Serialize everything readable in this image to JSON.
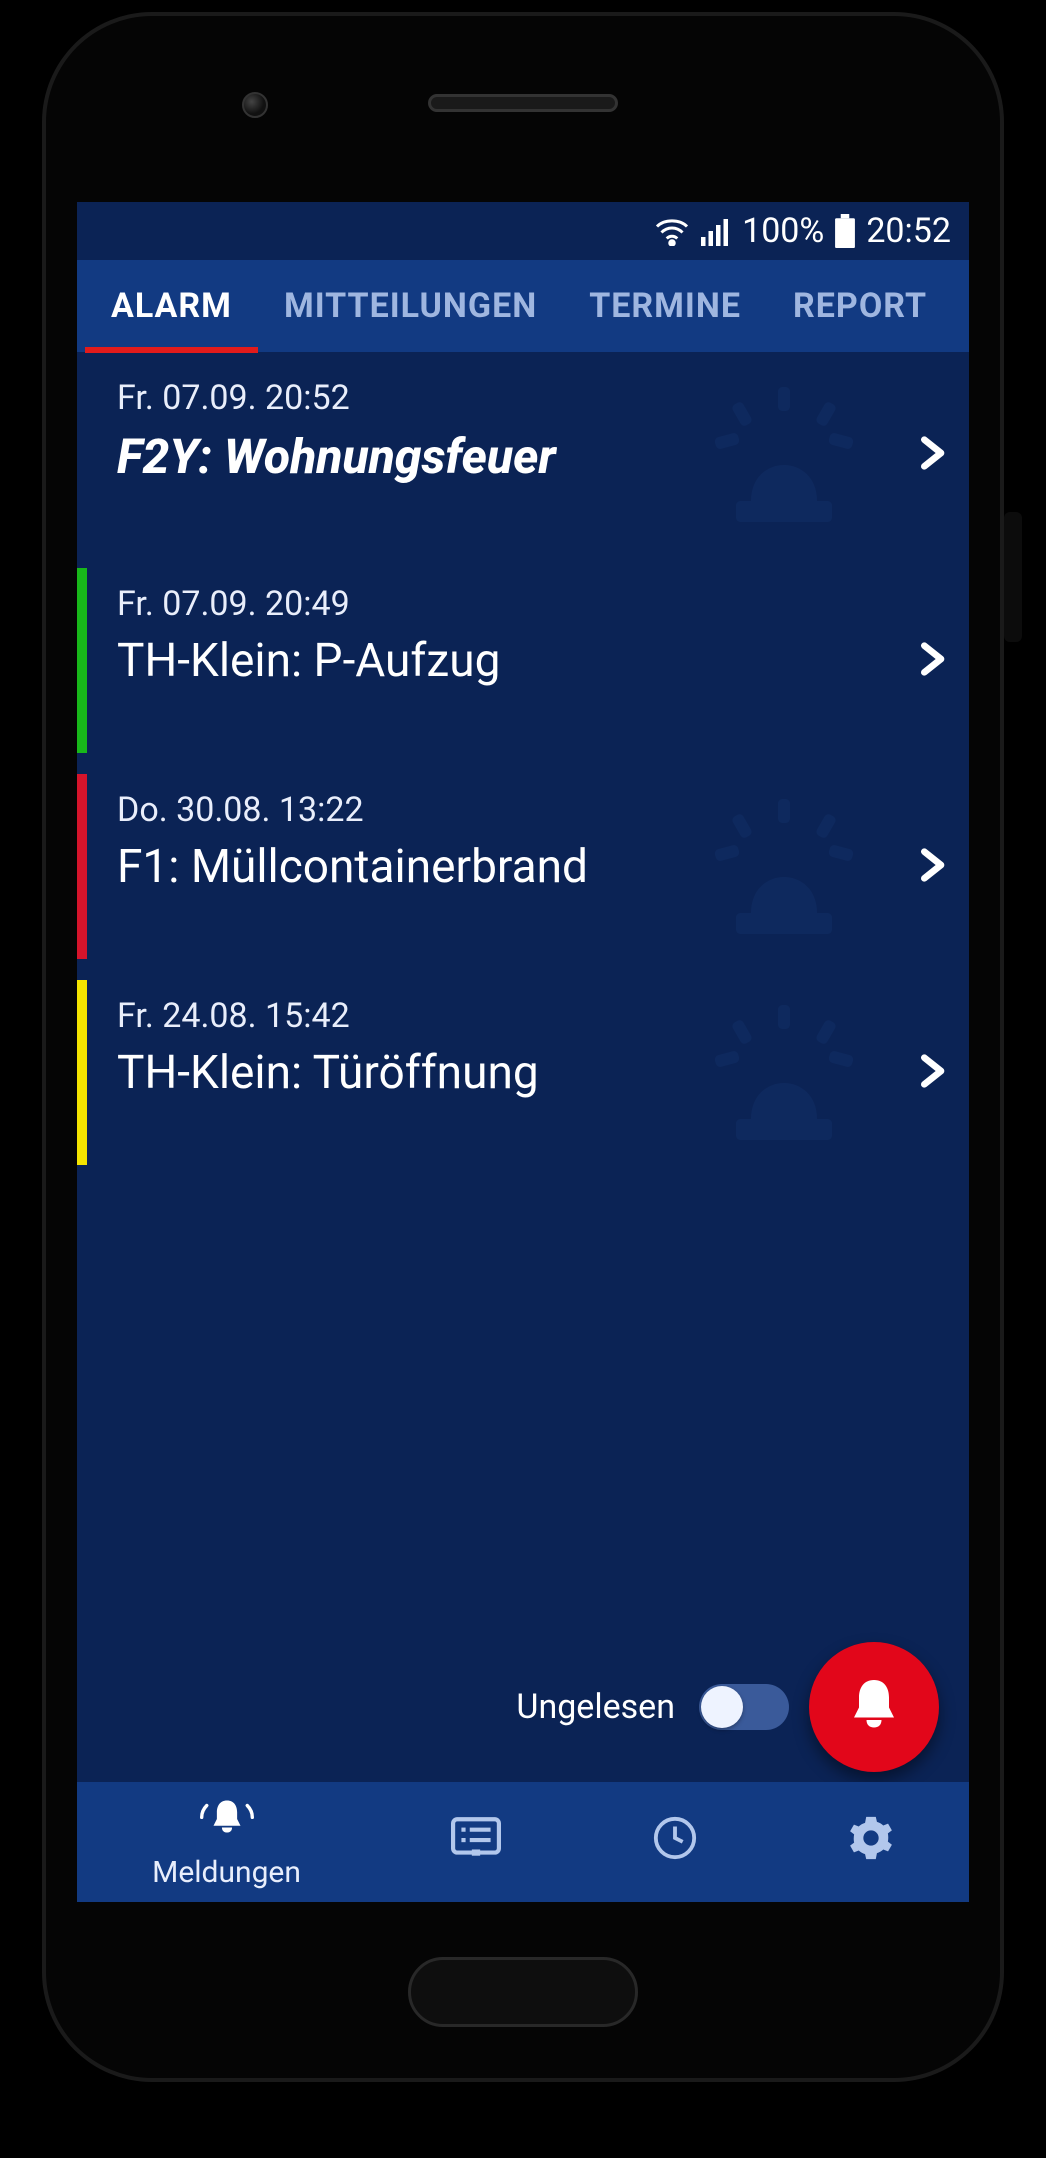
{
  "statusbar": {
    "battery_pct": "100%",
    "time": "20:52"
  },
  "tabs": [
    {
      "label": "ALARM",
      "active": true
    },
    {
      "label": "MITTEILUNGEN",
      "active": false
    },
    {
      "label": "TERMINE",
      "active": false
    },
    {
      "label": "REPORT",
      "active": false
    }
  ],
  "alarms": [
    {
      "date": "Fr. 07.09. 20:52",
      "title": "F2Y: Wohnungsfeuer",
      "stripe": null,
      "unread": true,
      "siren": true
    },
    {
      "date": "Fr. 07.09. 20:49",
      "title": "TH-Klein: P-Aufzug",
      "stripe": "#18b81a",
      "unread": false,
      "siren": false
    },
    {
      "date": "Do. 30.08. 13:22",
      "title": "F1: Müllcontainerbrand",
      "stripe": "#d6142b",
      "unread": false,
      "siren": true
    },
    {
      "date": "Fr. 24.08. 15:42",
      "title": "TH-Klein: Türöffnung",
      "stripe": "#f4e400",
      "unread": false,
      "siren": true
    }
  ],
  "unread_toggle": {
    "label": "Ungelesen",
    "on": false
  },
  "bottomnav": [
    {
      "name": "meldungen",
      "label": "Meldungen",
      "active": true
    },
    {
      "name": "board",
      "label": "",
      "active": false
    },
    {
      "name": "clock",
      "label": "",
      "active": false
    },
    {
      "name": "settings",
      "label": "",
      "active": false
    }
  ]
}
